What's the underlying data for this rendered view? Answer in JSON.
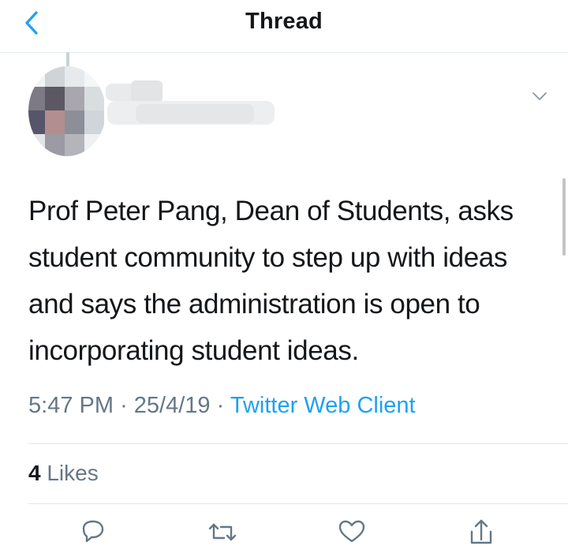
{
  "header": {
    "title": "Thread"
  },
  "tweet": {
    "text": "Prof Peter Pang, Dean of Students, asks student community to step up with ideas and says the administration is open to incorporating student ideas.",
    "time": "5:47 PM",
    "separator": "·",
    "date": "25/4/19",
    "source": "Twitter Web Client",
    "likes_count": "4",
    "likes_label": "Likes"
  },
  "icons": {
    "back": "chevron-left-icon",
    "caret": "chevron-down-icon",
    "reply": "reply-icon",
    "retweet": "retweet-icon",
    "like": "heart-icon",
    "share": "share-icon"
  },
  "colors": {
    "accent": "#1da1f2",
    "secondary_text": "#657786",
    "primary_text": "#14171a",
    "divider": "#e1e8ed"
  }
}
